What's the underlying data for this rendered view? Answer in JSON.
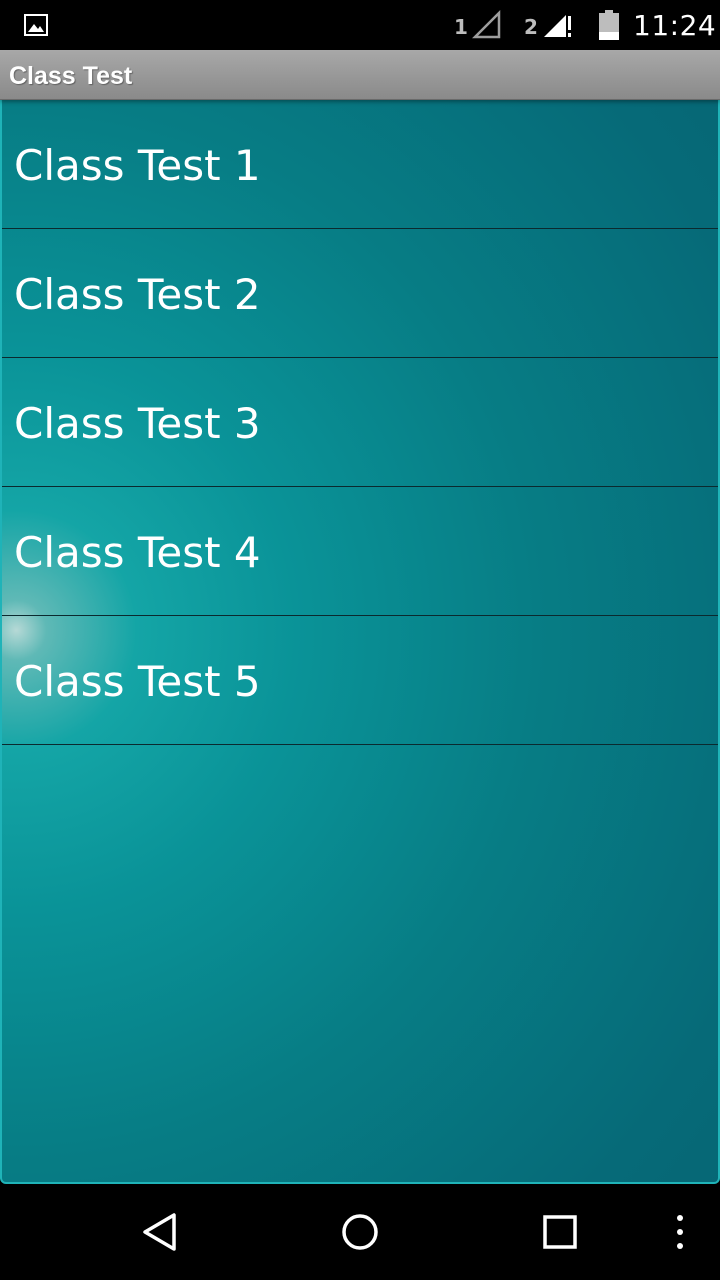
{
  "status_bar": {
    "time": "11:24",
    "sim1_label": "1",
    "sim2_label": "2",
    "icons": [
      "gallery-icon",
      "signal-sim1-icon",
      "signal-sim2-icon",
      "battery-icon"
    ]
  },
  "title_bar": {
    "title": "Class Test"
  },
  "list": {
    "items": [
      {
        "label": "Class Test 1"
      },
      {
        "label": "Class Test 2"
      },
      {
        "label": "Class Test 3"
      },
      {
        "label": "Class Test 4"
      },
      {
        "label": "Class Test 5"
      }
    ]
  },
  "nav_bar": {
    "icons": [
      "back-icon",
      "home-icon",
      "recents-icon",
      "overflow-menu-icon"
    ]
  },
  "colors": {
    "background_teal": "#0a9398",
    "title_bar_gray": "#9a9a9a",
    "text": "#ffffff"
  }
}
